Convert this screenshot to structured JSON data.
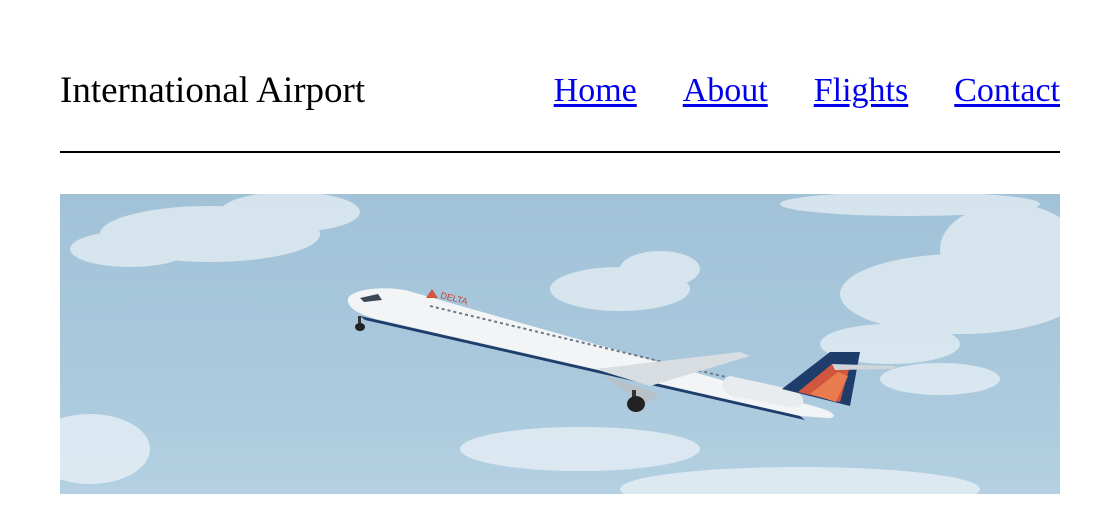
{
  "header": {
    "site_title": "International Airport",
    "nav": {
      "home_label": "Home",
      "about_label": "About",
      "flights_label": "Flights",
      "contact_label": "Contact"
    }
  },
  "hero": {
    "airline_livery_text": "DELTA"
  },
  "colors": {
    "link": "#0000ee",
    "text": "#000000",
    "sky": "#a9c8dc",
    "livery_blue": "#1f3d6b",
    "livery_red": "#d2563e"
  }
}
